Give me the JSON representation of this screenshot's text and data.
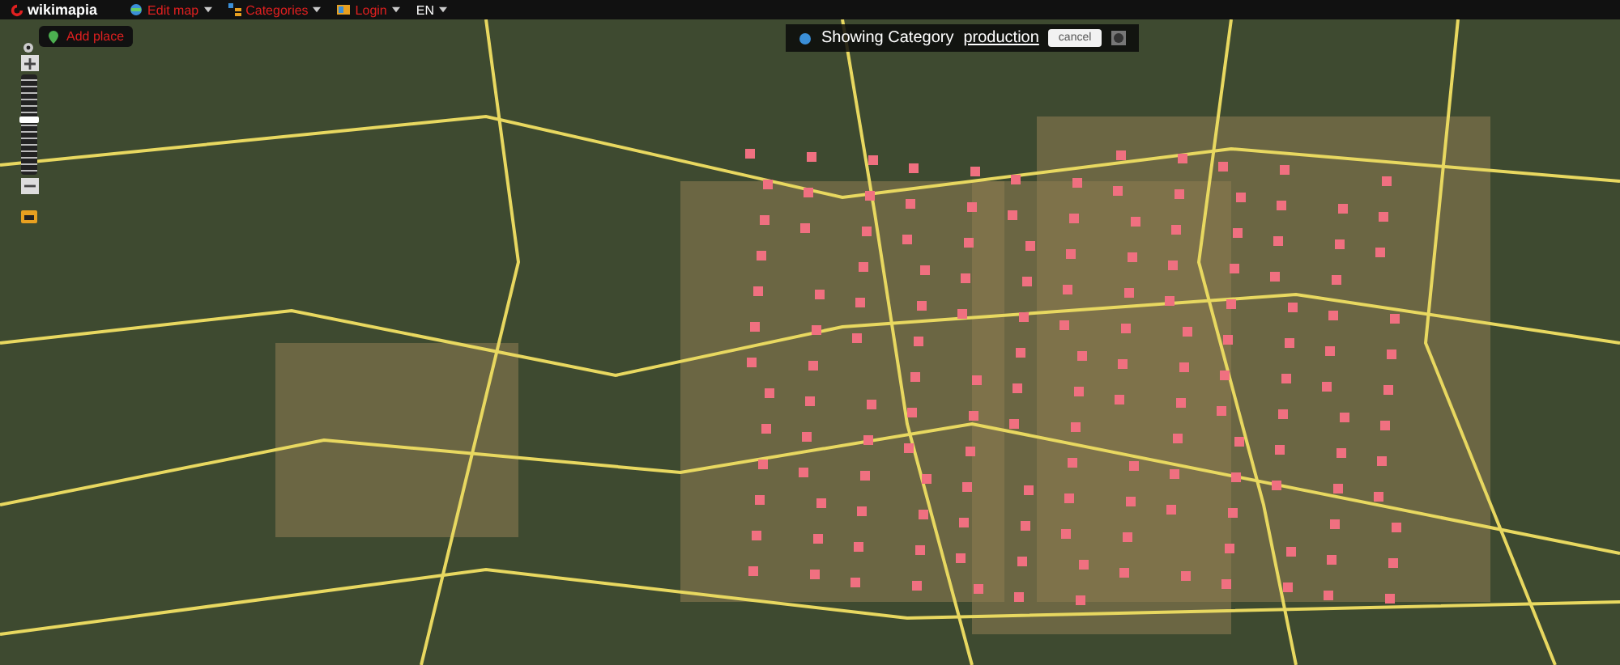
{
  "topbar": {
    "logo": "wikimapia",
    "menus": [
      {
        "kind": "edit",
        "label": "Edit map",
        "color": "#e02020"
      },
      {
        "kind": "categories",
        "label": "Categories",
        "color": "#e02020"
      },
      {
        "kind": "login",
        "label": "Login",
        "color": "#e02020"
      },
      {
        "kind": "language",
        "label": "EN",
        "color": "#ffffff"
      }
    ]
  },
  "add_place": {
    "label": "Add place"
  },
  "zoom": {
    "level": 0.55
  },
  "category_banner": {
    "prefix": "Showing Category",
    "category": "production",
    "cancel": "cancel"
  }
}
